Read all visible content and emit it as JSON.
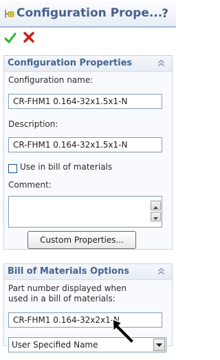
{
  "title": "Configuration Prope...",
  "help_label": "?",
  "colors": {
    "accent": "#47618b",
    "ok": "#3db33a",
    "cancel": "#d01818"
  },
  "icons": {
    "title": "configuration-icon",
    "ok": "checkmark-icon",
    "cancel": "x-icon",
    "collapse": "collapse-chevrons-icon",
    "cursor": "mouse-pointer-icon"
  },
  "config_properties": {
    "header": "Configuration Properties",
    "config_name_label": "Configuration name:",
    "config_name_value": "CR-FHM1 0.164-32x1.5x1-N",
    "description_label": "Description:",
    "description_value": "CR-FHM1 0.164-32x1.5x1-N",
    "use_in_bom_label": "Use in bill of materials",
    "use_in_bom_checked": false,
    "comment_label": "Comment:",
    "comment_value": "",
    "custom_properties_button": "Custom Properties..."
  },
  "bom_options": {
    "header": "Bill of Materials Options",
    "part_number_label_line1": "Part number displayed when",
    "part_number_label_line2": "used in a bill of materials:",
    "part_number_value": "CR-FHM1 0.164-32x2x1-N",
    "source_selected": "User Specified Name"
  }
}
